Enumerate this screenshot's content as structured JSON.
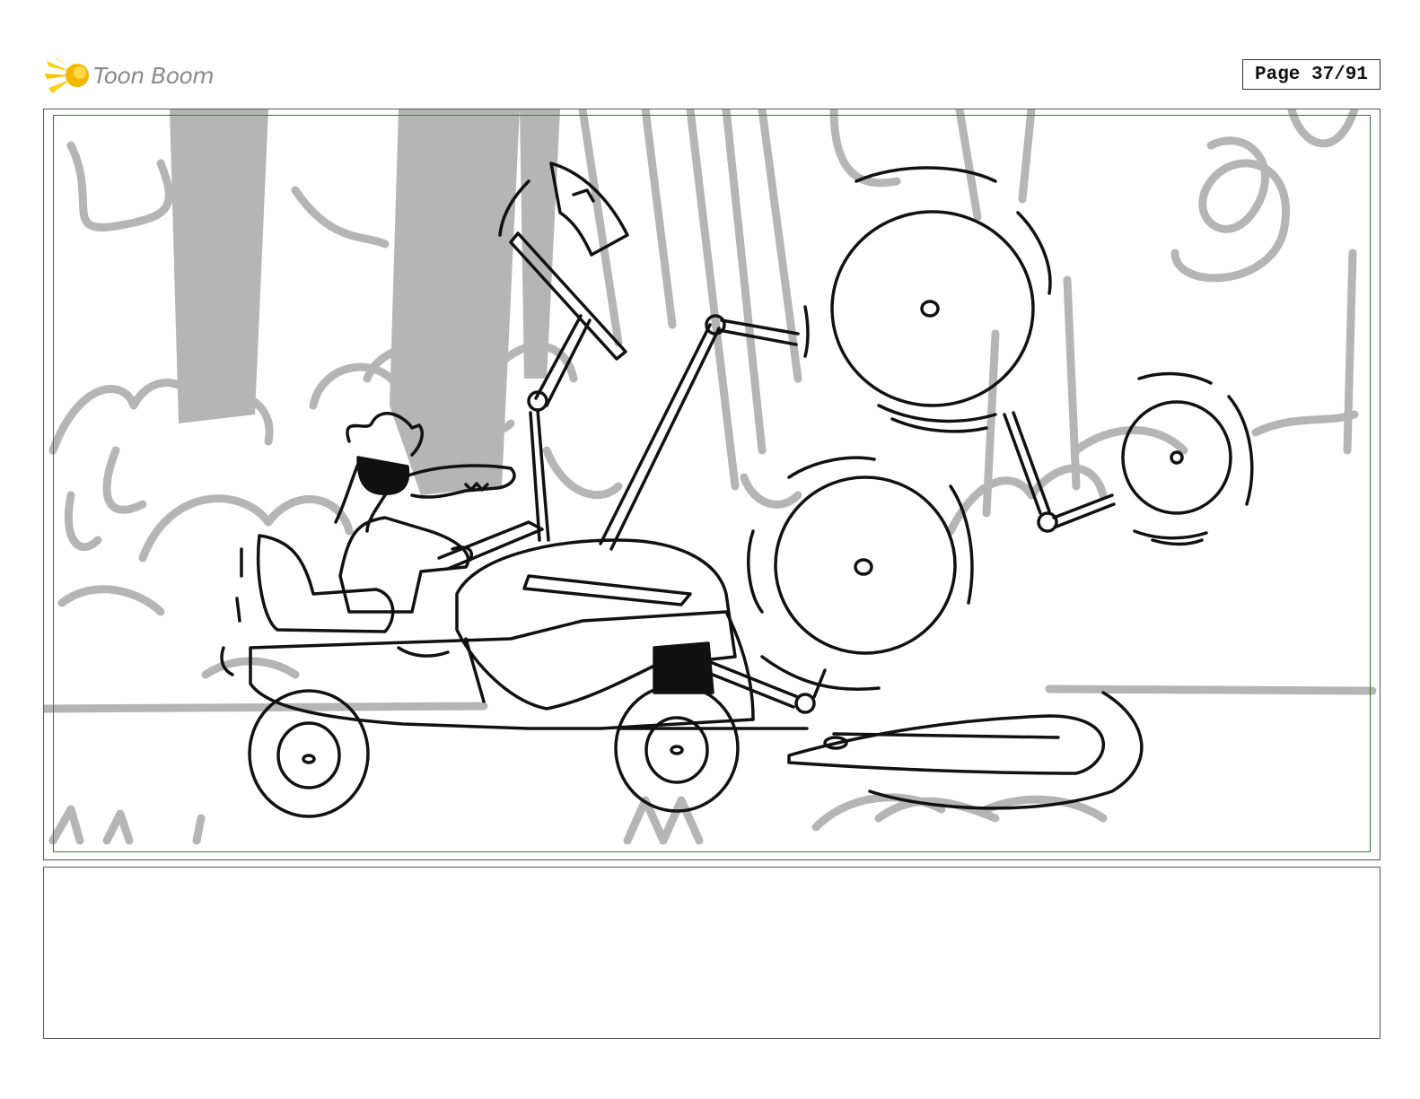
{
  "header": {
    "brand_name": "Toon Boom",
    "page_label": "Page 37/91"
  },
  "caption": {
    "text": ""
  },
  "colors": {
    "brand_accent": "#f5c400",
    "sketch_gray": "#b3b3b3",
    "ink": "#111111",
    "safe_frame": "#2e7d32"
  },
  "icons": [
    "toon-boom-comet-logo"
  ]
}
